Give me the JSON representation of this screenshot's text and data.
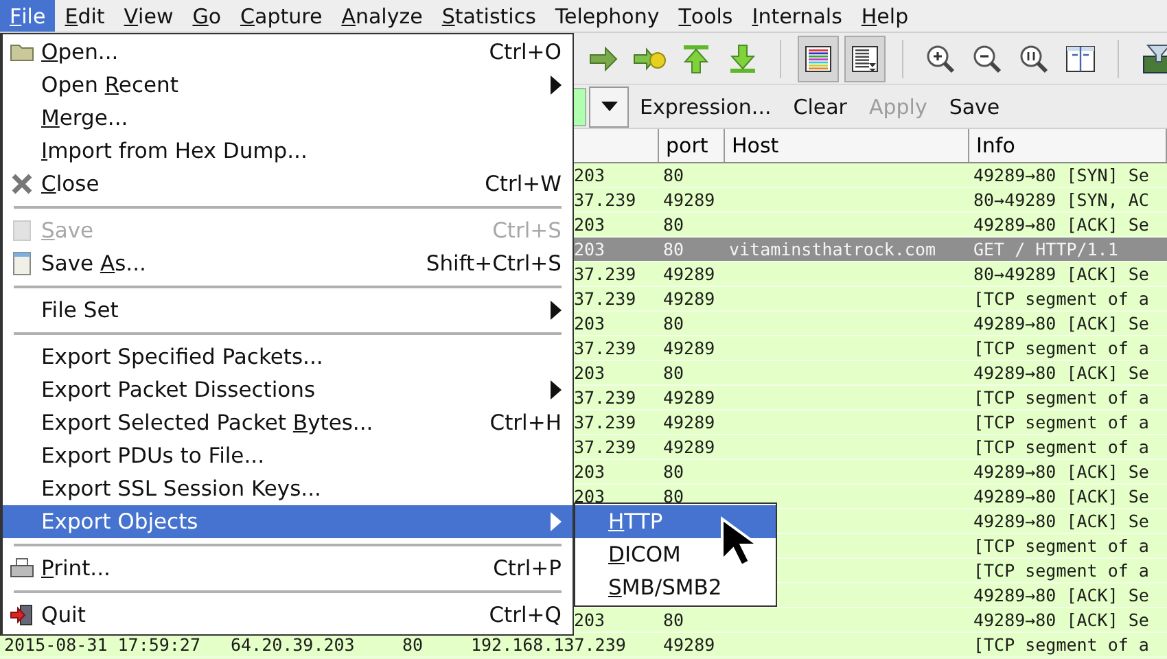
{
  "menubar": [
    {
      "key": "F",
      "post": "ile",
      "selected": true
    },
    {
      "key": "E",
      "post": "dit",
      "selected": false
    },
    {
      "key": "V",
      "post": "iew",
      "selected": false
    },
    {
      "key": "G",
      "post": "o",
      "selected": false
    },
    {
      "key": "C",
      "post": "apture",
      "selected": false
    },
    {
      "key": "A",
      "post": "nalyze",
      "selected": false
    },
    {
      "key": "S",
      "post": "tatistics",
      "selected": false
    },
    {
      "label": "Telephony",
      "selected": false
    },
    {
      "key": "T",
      "post": "ools",
      "selected": false
    },
    {
      "key": "I",
      "post": "nternals",
      "selected": false
    },
    {
      "key": "H",
      "post": "elp",
      "selected": false
    }
  ],
  "toolbar": [
    {
      "kind": "button"
    },
    {
      "kind": "button"
    },
    {
      "kind": "button"
    },
    {
      "kind": "button"
    },
    {
      "kind": "separator"
    },
    {
      "kind": "toggle",
      "pressed": true
    },
    {
      "kind": "toggle",
      "pressed": true
    },
    {
      "kind": "separator"
    },
    {
      "kind": "button"
    },
    {
      "kind": "button"
    },
    {
      "kind": "button"
    },
    {
      "kind": "button"
    },
    {
      "kind": "separator"
    },
    {
      "kind": "button"
    }
  ],
  "filter": {
    "buttons": [
      {
        "label": "Expression...",
        "disabled": false
      },
      {
        "label": "Clear",
        "disabled": false
      },
      {
        "label": "Apply",
        "disabled": true
      },
      {
        "label": "Save",
        "disabled": false
      }
    ]
  },
  "packet_list": {
    "columns": [
      "port",
      "Host",
      "Info"
    ],
    "rows": [
      {
        "kind": "covered",
        "destination": "203",
        "port": "80",
        "info": "49289→80 [SYN] Se",
        "selected": false
      },
      {
        "kind": "covered",
        "destination": "37.239",
        "port": "49289",
        "info": "80→49289 [SYN, AC",
        "selected": false
      },
      {
        "kind": "covered",
        "destination": "203",
        "port": "80",
        "info": "49289→80 [ACK] Se",
        "selected": false
      },
      {
        "kind": "covered",
        "destination": "203",
        "port": "80",
        "host": "vitaminsthatrock.com",
        "info": "GET / HTTP/1.1",
        "selected": true
      },
      {
        "kind": "covered",
        "destination": "37.239",
        "port": "49289",
        "info": "80→49289 [ACK] Se",
        "selected": false
      },
      {
        "kind": "covered",
        "destination": "37.239",
        "port": "49289",
        "info": "[TCP segment of a",
        "selected": false
      },
      {
        "kind": "covered",
        "destination": "203",
        "port": "80",
        "info": "49289→80 [ACK] Se",
        "selected": false
      },
      {
        "kind": "covered",
        "destination": "37.239",
        "port": "49289",
        "info": "[TCP segment of a",
        "selected": false
      },
      {
        "kind": "covered",
        "destination": "203",
        "port": "80",
        "info": "49289→80 [ACK] Se",
        "selected": false
      },
      {
        "kind": "covered",
        "destination": "37.239",
        "port": "49289",
        "info": "[TCP segment of a",
        "selected": false
      },
      {
        "kind": "covered",
        "destination": "37.239",
        "port": "49289",
        "info": "[TCP segment of a",
        "selected": false
      },
      {
        "kind": "covered",
        "destination": "37.239",
        "port": "49289",
        "info": "[TCP segment of a",
        "selected": false
      },
      {
        "kind": "covered",
        "destination": "203",
        "port": "80",
        "info": "49289→80 [ACK] Se",
        "selected": false
      },
      {
        "kind": "covered",
        "destination": "203",
        "port": "80",
        "info": "49289→80 [ACK] Se",
        "selected": false
      },
      {
        "kind": "covered",
        "info": "49289→80 [ACK] Se",
        "selected": false
      },
      {
        "kind": "covered",
        "info": "[TCP segment of a",
        "selected": false
      },
      {
        "kind": "covered",
        "info": "[TCP segment of a",
        "selected": false
      },
      {
        "kind": "covered",
        "info": "49289→80 [ACK] Se",
        "selected": false
      },
      {
        "kind": "covered",
        "destination": "203",
        "port": "80",
        "info": "49289→80 [ACK] Se",
        "selected": false
      },
      {
        "kind": "full",
        "time": "2015-08-31 17:59:27",
        "source": "64.20.39.203",
        "source_port": "80",
        "destination": "192.168.137.239",
        "port": "49289",
        "info": "[TCP segment of a",
        "selected": false
      }
    ]
  },
  "file_menu": {
    "items": [
      {
        "kind": "item",
        "key": "O",
        "post": "pen...",
        "shortcut": "Ctrl+O",
        "selected": false,
        "disabled": false
      },
      {
        "kind": "item",
        "pre": "Open ",
        "key": "R",
        "post": "ecent",
        "submenu": true,
        "selected": false,
        "disabled": false
      },
      {
        "kind": "item",
        "key": "M",
        "post": "erge...",
        "selected": false,
        "disabled": false
      },
      {
        "kind": "item",
        "key": "I",
        "post": "mport from Hex Dump...",
        "selected": false,
        "disabled": false
      },
      {
        "kind": "item",
        "key": "C",
        "post": "lose",
        "shortcut": "Ctrl+W",
        "selected": false,
        "disabled": false
      },
      {
        "kind": "separator"
      },
      {
        "kind": "item",
        "key": "S",
        "post": "ave",
        "shortcut": "Ctrl+S",
        "selected": false,
        "disabled": true
      },
      {
        "kind": "item",
        "pre": "Save ",
        "key": "A",
        "post": "s...",
        "shortcut": "Shift+Ctrl+S",
        "selected": false,
        "disabled": false
      },
      {
        "kind": "separator"
      },
      {
        "kind": "item",
        "label": "File Set",
        "submenu": true,
        "selected": false,
        "disabled": false
      },
      {
        "kind": "separator"
      },
      {
        "kind": "item",
        "label": "Export Specified Packets...",
        "selected": false,
        "disabled": false
      },
      {
        "kind": "item",
        "label": "Export Packet Dissections",
        "submenu": true,
        "selected": false,
        "disabled": false
      },
      {
        "kind": "item",
        "pre": "Export Selected Packet ",
        "key": "B",
        "post": "ytes...",
        "shortcut": "Ctrl+H",
        "selected": false,
        "disabled": false
      },
      {
        "kind": "item",
        "label": "Export PDUs to File...",
        "selected": false,
        "disabled": false
      },
      {
        "kind": "item",
        "label": "Export SSL Session Keys...",
        "selected": false,
        "disabled": false
      },
      {
        "kind": "item",
        "label": "Export Objects",
        "submenu": true,
        "selected": true,
        "disabled": false
      },
      {
        "kind": "separator"
      },
      {
        "kind": "item",
        "key": "P",
        "post": "rint...",
        "shortcut": "Ctrl+P",
        "selected": false,
        "disabled": false
      },
      {
        "kind": "separator"
      },
      {
        "kind": "item",
        "label": "Quit",
        "shortcut": "Ctrl+Q",
        "selected": false,
        "disabled": false
      }
    ]
  },
  "export_objects_submenu": {
    "items": [
      {
        "key": "H",
        "post": "TTP",
        "selected": true
      },
      {
        "key": "D",
        "post": "ICOM",
        "selected": false
      },
      {
        "key": "S",
        "post": "MB/SMB2",
        "selected": false
      }
    ]
  }
}
